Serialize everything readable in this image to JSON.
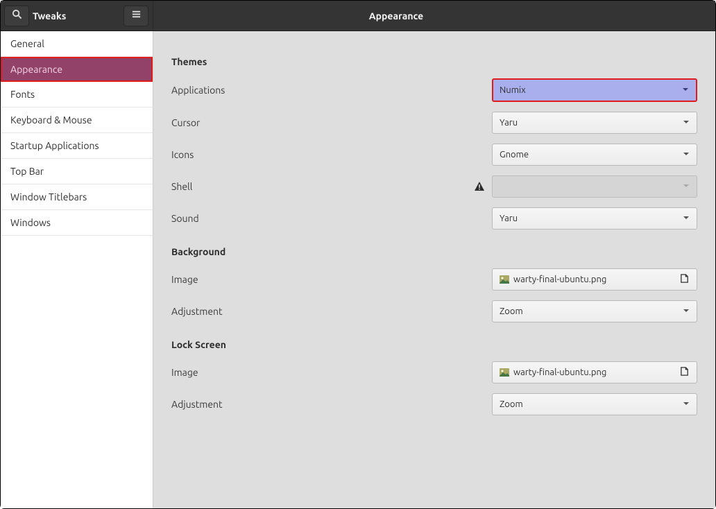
{
  "header": {
    "sidebar_title": "Tweaks",
    "content_title": "Appearance"
  },
  "sidebar": {
    "items": [
      {
        "label": "General"
      },
      {
        "label": "Appearance"
      },
      {
        "label": "Fonts"
      },
      {
        "label": "Keyboard & Mouse"
      },
      {
        "label": "Startup Applications"
      },
      {
        "label": "Top Bar"
      },
      {
        "label": "Window Titlebars"
      },
      {
        "label": "Windows"
      }
    ],
    "active_index": 1
  },
  "sections": {
    "themes": {
      "heading": "Themes",
      "applications": {
        "label": "Applications",
        "value": "Numix"
      },
      "cursor": {
        "label": "Cursor",
        "value": "Yaru"
      },
      "icons": {
        "label": "Icons",
        "value": "Gnome"
      },
      "shell": {
        "label": "Shell",
        "value": ""
      },
      "sound": {
        "label": "Sound",
        "value": "Yaru"
      }
    },
    "background": {
      "heading": "Background",
      "image": {
        "label": "Image",
        "value": "warty-final-ubuntu.png"
      },
      "adjustment": {
        "label": "Adjustment",
        "value": "Zoom"
      }
    },
    "lockscreen": {
      "heading": "Lock Screen",
      "image": {
        "label": "Image",
        "value": "warty-final-ubuntu.png"
      },
      "adjustment": {
        "label": "Adjustment",
        "value": "Zoom"
      }
    }
  }
}
